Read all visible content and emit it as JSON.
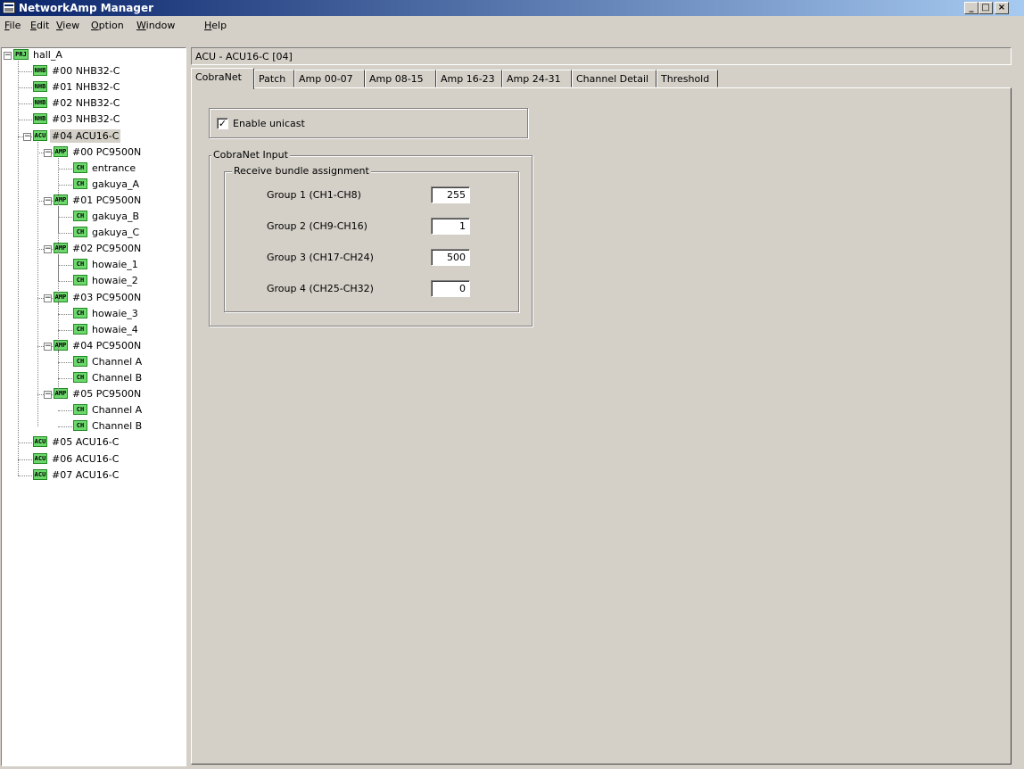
{
  "window": {
    "title": "NetworkAmp Manager"
  },
  "menu": [
    {
      "first": "F",
      "rest": "ile"
    },
    {
      "first": "E",
      "rest": "dit"
    },
    {
      "first": "V",
      "rest": "iew"
    },
    {
      "first": "O",
      "rest": "ption"
    },
    {
      "first": "W",
      "rest": "indow"
    },
    {
      "first": "H",
      "rest": "elp"
    }
  ],
  "tree": [
    {
      "badge": "PRJ",
      "label": "hall_A",
      "expanded": true
    },
    {
      "badge": "NHB",
      "label": "#00 NHB32-C"
    },
    {
      "badge": "NHB",
      "label": "#01 NHB32-C"
    },
    {
      "badge": "NHB",
      "label": "#02 NHB32-C"
    },
    {
      "badge": "NHB",
      "label": "#03 NHB32-C"
    },
    {
      "badge": "ACU",
      "label": "#04 ACU16-C",
      "expanded": true,
      "selected": true
    },
    {
      "badge": "AMP",
      "label": "#00 PC9500N",
      "expanded": true
    },
    {
      "badge": "CH",
      "label": "entrance"
    },
    {
      "badge": "CH",
      "label": "gakuya_A"
    },
    {
      "badge": "AMP",
      "label": "#01 PC9500N",
      "expanded": true
    },
    {
      "badge": "CH",
      "label": "gakuya_B"
    },
    {
      "badge": "CH",
      "label": "gakuya_C"
    },
    {
      "badge": "AMP",
      "label": "#02 PC9500N",
      "expanded": true
    },
    {
      "badge": "CH",
      "label": "howaie_1"
    },
    {
      "badge": "CH",
      "label": "howaie_2"
    },
    {
      "badge": "AMP",
      "label": "#03 PC9500N",
      "expanded": true
    },
    {
      "badge": "CH",
      "label": "howaie_3"
    },
    {
      "badge": "CH",
      "label": "howaie_4"
    },
    {
      "badge": "AMP",
      "label": "#04 PC9500N",
      "expanded": true
    },
    {
      "badge": "CH",
      "label": "Channel A"
    },
    {
      "badge": "CH",
      "label": "Channel B"
    },
    {
      "badge": "AMP",
      "label": "#05 PC9500N",
      "expanded": true
    },
    {
      "badge": "CH",
      "label": "Channel A"
    },
    {
      "badge": "CH",
      "label": "Channel B"
    },
    {
      "badge": "ACU",
      "label": "#05 ACU16-C"
    },
    {
      "badge": "ACU",
      "label": "#06 ACU16-C"
    },
    {
      "badge": "ACU",
      "label": "#07 ACU16-C"
    }
  ],
  "main": {
    "header": "ACU - ACU16-C [04]",
    "tabs": [
      "CobraNet",
      "Patch",
      "Amp 00-07",
      "Amp 08-15",
      "Amp 16-23",
      "Amp 24-31",
      "Channel Detail",
      "Threshold"
    ],
    "active_tab": "CobraNet",
    "unicast": {
      "label": "Enable unicast",
      "checked": true,
      "mark": "✓"
    },
    "cobranet_input": {
      "title": "CobraNet Input",
      "bundle_title": "Receive bundle assignment",
      "groups": [
        {
          "label": "Group 1 (CH1-CH8)",
          "value": "255"
        },
        {
          "label": "Group 2 (CH9-CH16)",
          "value": "1"
        },
        {
          "label": "Group 3 (CH17-CH24)",
          "value": "500"
        },
        {
          "label": "Group 4 (CH25-CH32)",
          "value": "0"
        }
      ]
    }
  }
}
